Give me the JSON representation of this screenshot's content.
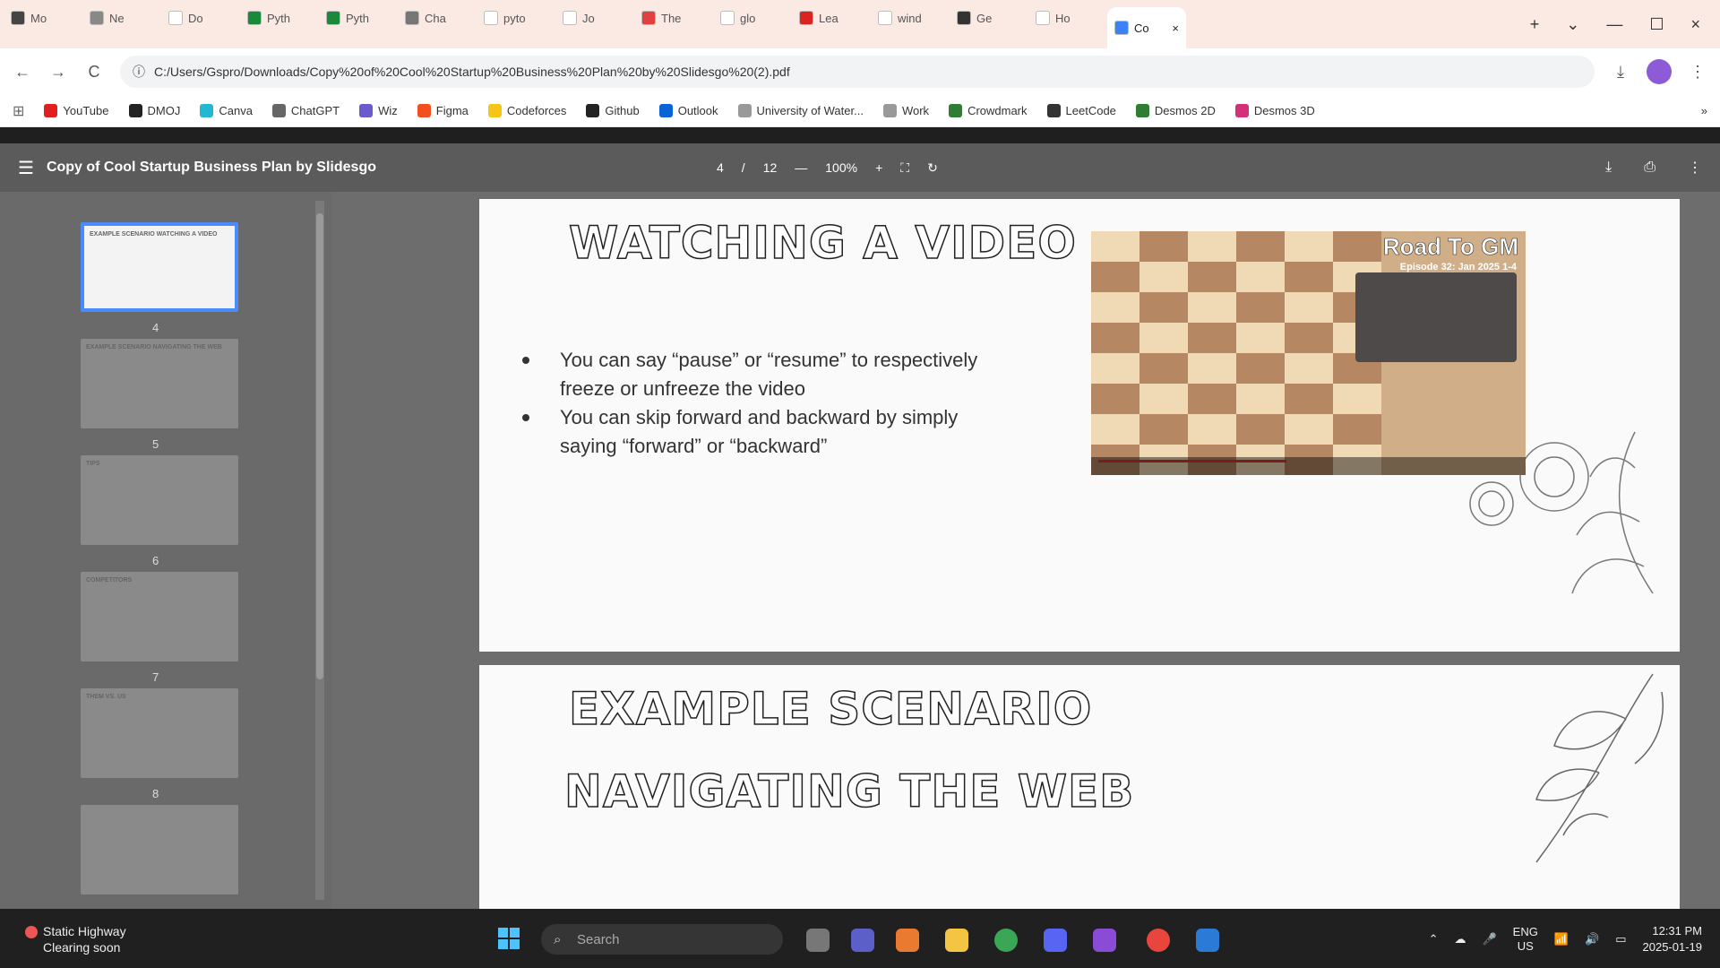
{
  "tabs": [
    {
      "label": "Mo",
      "color": "#444"
    },
    {
      "label": "Ne",
      "color": "#888"
    },
    {
      "label": "Do",
      "color": "#fff"
    },
    {
      "label": "Pyth",
      "color": "#1a8a3a"
    },
    {
      "label": "Pyth",
      "color": "#1a8a3a"
    },
    {
      "label": "Cha",
      "color": "#777"
    },
    {
      "label": "pyto",
      "color": "#fff"
    },
    {
      "label": "Jo",
      "color": "#fff"
    },
    {
      "label": "The",
      "color": "#e04040"
    },
    {
      "label": "glo",
      "color": "#fff"
    },
    {
      "label": "Lea",
      "color": "#d22"
    },
    {
      "label": "wind",
      "color": "#fff"
    },
    {
      "label": "Ge",
      "color": "#333"
    },
    {
      "label": "Ho",
      "color": "#fff"
    },
    {
      "label": "Co",
      "color": "#3b82f6",
      "active": true
    }
  ],
  "tab_controls": {
    "close": "×",
    "new": "+",
    "dropdown": "⌄",
    "minimize": "—",
    "maximize": "☐",
    "close_window": "×"
  },
  "address": {
    "url": "C:/Users/Gspro/Downloads/Copy%20of%20Cool%20Startup%20Business%20Plan%20by%20Slidesgo%20(2).pdf",
    "back": "←",
    "forward": "→",
    "reload": "C",
    "info": "ⓘ",
    "download": "⤓",
    "menu": "⋮"
  },
  "bookmarks": [
    {
      "label": "YouTube",
      "color": "#e02020"
    },
    {
      "label": "DMOJ",
      "color": "#222"
    },
    {
      "label": "Canva",
      "color": "#22b8cf"
    },
    {
      "label": "ChatGPT",
      "color": "#666"
    },
    {
      "label": "Wiz",
      "color": "#6a5acd"
    },
    {
      "label": "Figma",
      "color": "#f24e1e"
    },
    {
      "label": "Codeforces",
      "color": "#f5c518"
    },
    {
      "label": "Github",
      "color": "#222"
    },
    {
      "label": "Outlook",
      "color": "#0a64d8"
    },
    {
      "label": "University of Water...",
      "color": "#999"
    },
    {
      "label": "Work",
      "color": "#999"
    },
    {
      "label": "Crowdmark",
      "color": "#2e7d32"
    },
    {
      "label": "LeetCode",
      "color": "#333"
    },
    {
      "label": "Desmos 2D",
      "color": "#2e7d32"
    },
    {
      "label": "Desmos 3D",
      "color": "#d4307a"
    }
  ],
  "bookmarks_more": "»",
  "viewer": {
    "title": "Copy of Cool Startup Business Plan by Slidesgo",
    "page": "4",
    "page_sep": "/",
    "page_total": "12",
    "zoom_out": "—",
    "zoom": "100%",
    "zoom_in": "+",
    "menu_icon": "☰"
  },
  "thumbnails": [
    {
      "num": "",
      "text": "EXAMPLE SCENARIO WATCHING A VIDEO",
      "selected": true
    },
    {
      "num": "4",
      "text": "EXAMPLE SCENARIO NAVIGATING THE WEB"
    },
    {
      "num": "5",
      "text": "TIPS"
    },
    {
      "num": "6",
      "text": "COMPETITORS"
    },
    {
      "num": "7",
      "text": "THEM VS. US"
    },
    {
      "num": "8",
      "text": ""
    }
  ],
  "slide1": {
    "heading": "WATCHING A VIDEO",
    "bullets": [
      "You can say “pause” or “resume” to respectively freeze or unfreeze the video",
      "You can skip forward and backward by simply saying “forward” or “backward”"
    ]
  },
  "video": {
    "title": "Road To GM",
    "subtitle": "Episode 32: Jan 2025 1-4"
  },
  "slide2": {
    "heading1": "EXAMPLE SCENARIO",
    "heading2": "NAVIGATING THE WEB"
  },
  "taskbar": {
    "notif_line1": "Static Highway",
    "notif_line2": "Clearing soon",
    "search_placeholder": "Search",
    "lang1": "ENG",
    "lang2": "US",
    "time": "12:31 PM",
    "date": "2025-01-19"
  },
  "colors": {
    "accent": "#4a8cff",
    "tab_bg": "#fbe9e4",
    "video_progress": "#dd3333"
  }
}
